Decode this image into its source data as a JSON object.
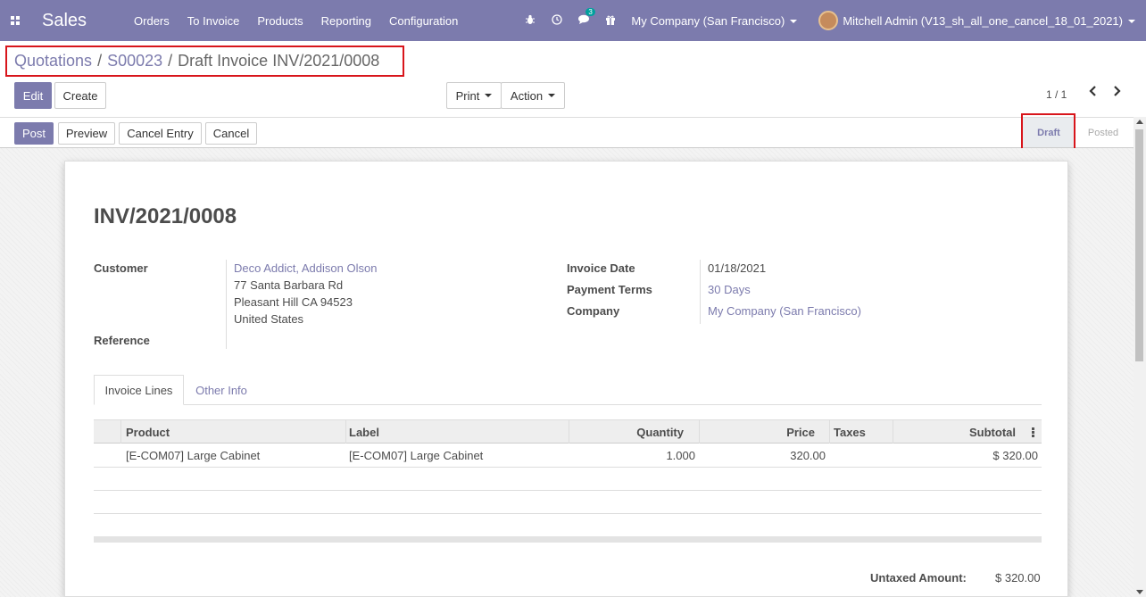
{
  "navbar": {
    "app_name": "Sales",
    "menu": [
      "Orders",
      "To Invoice",
      "Products",
      "Reporting",
      "Configuration"
    ],
    "messages_badge": "3",
    "company": "My Company (San Francisco)",
    "user": "Mitchell Admin (V13_sh_all_one_cancel_18_01_2021)",
    "color": "#7c7bad"
  },
  "breadcrumb": {
    "items": [
      "Quotations",
      "S00023",
      "Draft Invoice INV/2021/0008"
    ],
    "separator": "/"
  },
  "control": {
    "edit_label": "Edit",
    "create_label": "Create",
    "print_label": "Print",
    "action_label": "Action",
    "pager": "1 / 1"
  },
  "statusbar": {
    "post_label": "Post",
    "preview_label": "Preview",
    "cancel_entry_label": "Cancel Entry",
    "cancel_label": "Cancel",
    "stages": [
      "Draft",
      "Posted"
    ],
    "active_stage": "Draft"
  },
  "invoice": {
    "number": "INV/2021/0008",
    "customer_label": "Customer",
    "customer_name": "Deco Addict, Addison Olson",
    "address": [
      "77 Santa Barbara Rd",
      "Pleasant Hill CA 94523",
      "United States"
    ],
    "reference_label": "Reference",
    "invoice_date_label": "Invoice Date",
    "invoice_date": "01/18/2021",
    "payment_terms_label": "Payment Terms",
    "payment_terms": "30 Days",
    "company_label": "Company",
    "company": "My Company (San Francisco)"
  },
  "tabs": [
    "Invoice Lines",
    "Other Info"
  ],
  "lines": {
    "headers": [
      "Product",
      "Label",
      "Quantity",
      "Price",
      "Taxes",
      "Subtotal"
    ],
    "rows": [
      {
        "product": "[E-COM07] Large Cabinet",
        "label": "[E-COM07] Large Cabinet",
        "quantity": "1.000",
        "price": "320.00",
        "taxes": "",
        "subtotal": "$ 320.00"
      }
    ]
  },
  "totals": {
    "untaxed_label": "Untaxed Amount:",
    "untaxed_value": "$ 320.00"
  },
  "icons": {
    "apps": "apps-icon",
    "bug": "bug-icon",
    "clock": "clock-icon",
    "chat": "chat-icon",
    "gift": "gift-icon",
    "prev": "chevron-left-icon",
    "next": "chevron-right-icon",
    "column_options": "kebab-icon"
  }
}
